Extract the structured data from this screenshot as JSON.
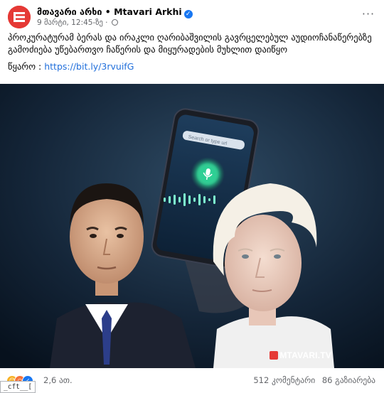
{
  "post": {
    "page_name": "მთავარი არხი • Mtavari Arkhi",
    "date": "9 მარტი, 12:45-ზე",
    "dot": "·",
    "more_label": "···",
    "verified_mark": "✓",
    "text_main": "პროკურატურამ ბერას და ირაკლი ღარიბაშვილის გავრცელებულ აუდიოჩანაწერებზე გამოძიება უწებართვო ჩაწერის და მიყურადების მუხლით დაიწყო",
    "source_prefix": "წყარო :",
    "source_link": "https://bit.ly/3rvuifG",
    "icons": [
      "mtavari-logo-icon",
      "verified-icon",
      "globe-icon",
      "more-icon"
    ]
  },
  "media": {
    "phone_search_placeholder": "Search or type url",
    "watermark": "MTAVARI.TV"
  },
  "footer": {
    "reaction_icons": [
      "laugh-reaction-icon",
      "wow-reaction-icon",
      "like-reaction-icon"
    ],
    "reaction_count": "2,6 ათ.",
    "comments": "512 კომენტარი",
    "shares": "86 გაზიარება"
  },
  "overlay": {
    "tag_text": "_cft__["
  },
  "colors": {
    "link": "#216fdb",
    "brand_red": "#e53935",
    "verified_blue": "#1877f2",
    "muted_text": "#65676b"
  }
}
